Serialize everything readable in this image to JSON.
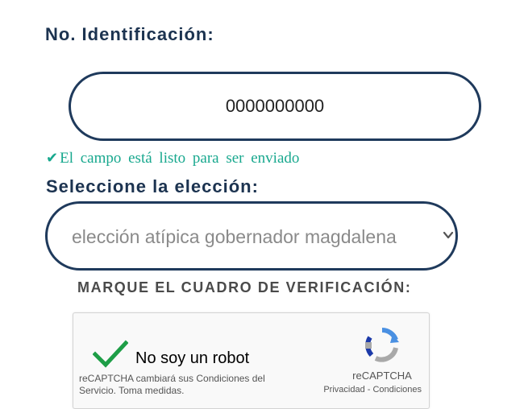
{
  "form": {
    "id_label": "No. Identificación:",
    "id_value": "0000000000",
    "validation_message": "El campo está listo para ser enviado",
    "election_label": "Seleccione la elección:",
    "election_selected": "elección atípica gobernador magdalena",
    "captcha_label": "MARQUE EL CUADRO DE VERIFICACIÓN:"
  },
  "captcha": {
    "checkbox_text": "No soy un robot",
    "notice": "reCAPTCHA cambiará sus Condiciones del Servicio. Toma medidas.",
    "brand": "reCAPTCHA",
    "links": "Privacidad - Condiciones"
  },
  "colors": {
    "heading": "#1c3350",
    "border": "#1f3a5c",
    "valid": "#18a88e",
    "check": "#1e9e47"
  },
  "icons": {
    "valid": "check-icon",
    "select": "chevron-down-icon",
    "captcha_check": "checkmark-icon",
    "recaptcha_logo": "recaptcha-logo-icon"
  }
}
